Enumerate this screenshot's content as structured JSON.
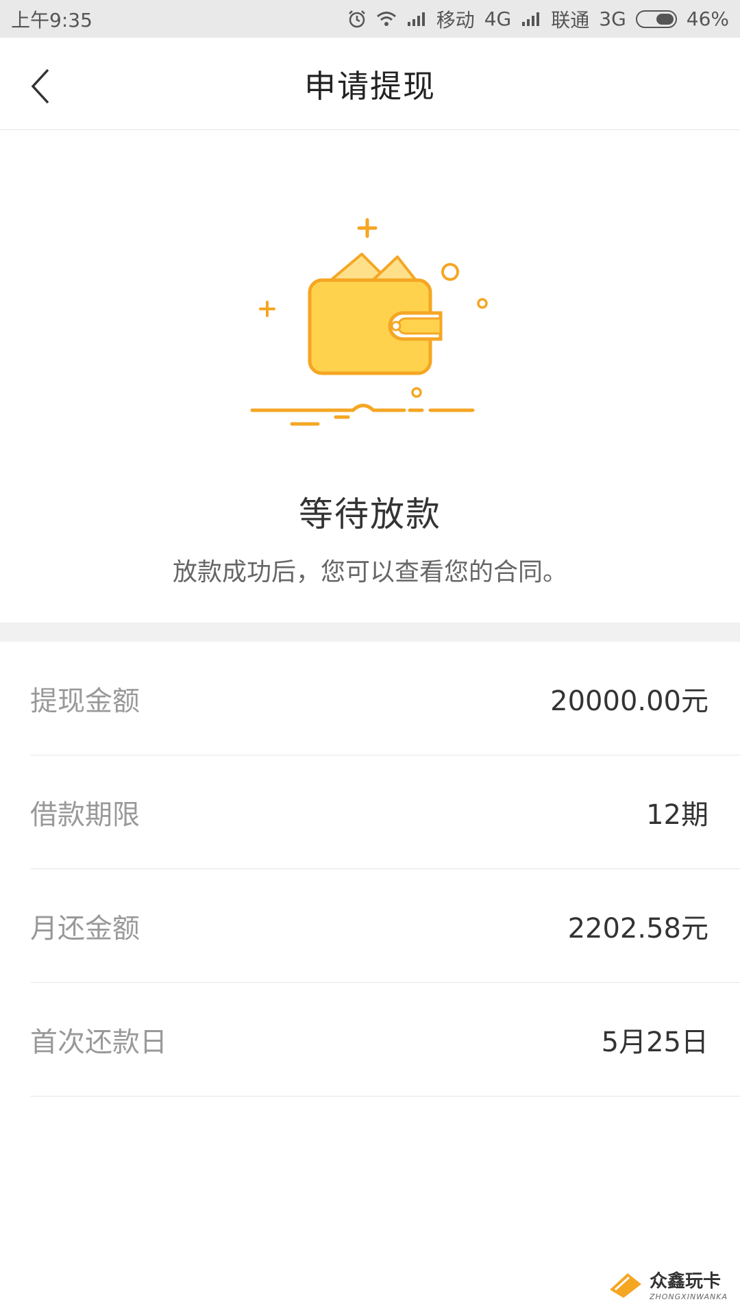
{
  "status_bar": {
    "time": "上午9:35",
    "carrier1": "移动",
    "network1": "4G",
    "carrier2": "联通",
    "network2": "3G",
    "battery": "46%",
    "battery_level": 0.46,
    "icons": [
      "alarm-icon",
      "wifi-icon",
      "signal-icon",
      "signal-icon",
      "battery-icon"
    ]
  },
  "header": {
    "title": "申请提现",
    "back_icon": "chevron-left-icon"
  },
  "hero": {
    "illustration": "wallet-icon",
    "status_title": "等待放款",
    "status_subtitle": "放款成功后，您可以查看您的合同。",
    "accent_color": "#f5a623",
    "fill_color": "#ffd24d"
  },
  "details": [
    {
      "label": "提现金额",
      "value": "20000.00元"
    },
    {
      "label": "借款期限",
      "value": "12期"
    },
    {
      "label": "月还金额",
      "value": "2202.58元"
    },
    {
      "label": "首次还款日",
      "value": "5月25日"
    }
  ],
  "watermark": {
    "cn": "众鑫玩卡",
    "en": "ZHONGXINWANKA"
  }
}
